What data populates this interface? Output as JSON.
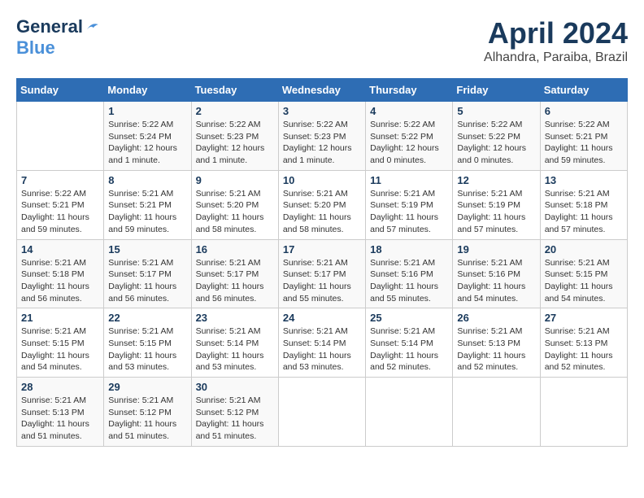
{
  "logo": {
    "text_general": "General",
    "text_blue": "Blue"
  },
  "header": {
    "title": "April 2024",
    "subtitle": "Alhandra, Paraiba, Brazil"
  },
  "weekdays": [
    "Sunday",
    "Monday",
    "Tuesday",
    "Wednesday",
    "Thursday",
    "Friday",
    "Saturday"
  ],
  "weeks": [
    [
      {
        "day": "",
        "info": ""
      },
      {
        "day": "1",
        "info": "Sunrise: 5:22 AM\nSunset: 5:24 PM\nDaylight: 12 hours\nand 1 minute."
      },
      {
        "day": "2",
        "info": "Sunrise: 5:22 AM\nSunset: 5:23 PM\nDaylight: 12 hours\nand 1 minute."
      },
      {
        "day": "3",
        "info": "Sunrise: 5:22 AM\nSunset: 5:23 PM\nDaylight: 12 hours\nand 1 minute."
      },
      {
        "day": "4",
        "info": "Sunrise: 5:22 AM\nSunset: 5:22 PM\nDaylight: 12 hours\nand 0 minutes."
      },
      {
        "day": "5",
        "info": "Sunrise: 5:22 AM\nSunset: 5:22 PM\nDaylight: 12 hours\nand 0 minutes."
      },
      {
        "day": "6",
        "info": "Sunrise: 5:22 AM\nSunset: 5:21 PM\nDaylight: 11 hours\nand 59 minutes."
      }
    ],
    [
      {
        "day": "7",
        "info": "Sunrise: 5:22 AM\nSunset: 5:21 PM\nDaylight: 11 hours\nand 59 minutes."
      },
      {
        "day": "8",
        "info": "Sunrise: 5:21 AM\nSunset: 5:21 PM\nDaylight: 11 hours\nand 59 minutes."
      },
      {
        "day": "9",
        "info": "Sunrise: 5:21 AM\nSunset: 5:20 PM\nDaylight: 11 hours\nand 58 minutes."
      },
      {
        "day": "10",
        "info": "Sunrise: 5:21 AM\nSunset: 5:20 PM\nDaylight: 11 hours\nand 58 minutes."
      },
      {
        "day": "11",
        "info": "Sunrise: 5:21 AM\nSunset: 5:19 PM\nDaylight: 11 hours\nand 57 minutes."
      },
      {
        "day": "12",
        "info": "Sunrise: 5:21 AM\nSunset: 5:19 PM\nDaylight: 11 hours\nand 57 minutes."
      },
      {
        "day": "13",
        "info": "Sunrise: 5:21 AM\nSunset: 5:18 PM\nDaylight: 11 hours\nand 57 minutes."
      }
    ],
    [
      {
        "day": "14",
        "info": "Sunrise: 5:21 AM\nSunset: 5:18 PM\nDaylight: 11 hours\nand 56 minutes."
      },
      {
        "day": "15",
        "info": "Sunrise: 5:21 AM\nSunset: 5:17 PM\nDaylight: 11 hours\nand 56 minutes."
      },
      {
        "day": "16",
        "info": "Sunrise: 5:21 AM\nSunset: 5:17 PM\nDaylight: 11 hours\nand 56 minutes."
      },
      {
        "day": "17",
        "info": "Sunrise: 5:21 AM\nSunset: 5:17 PM\nDaylight: 11 hours\nand 55 minutes."
      },
      {
        "day": "18",
        "info": "Sunrise: 5:21 AM\nSunset: 5:16 PM\nDaylight: 11 hours\nand 55 minutes."
      },
      {
        "day": "19",
        "info": "Sunrise: 5:21 AM\nSunset: 5:16 PM\nDaylight: 11 hours\nand 54 minutes."
      },
      {
        "day": "20",
        "info": "Sunrise: 5:21 AM\nSunset: 5:15 PM\nDaylight: 11 hours\nand 54 minutes."
      }
    ],
    [
      {
        "day": "21",
        "info": "Sunrise: 5:21 AM\nSunset: 5:15 PM\nDaylight: 11 hours\nand 54 minutes."
      },
      {
        "day": "22",
        "info": "Sunrise: 5:21 AM\nSunset: 5:15 PM\nDaylight: 11 hours\nand 53 minutes."
      },
      {
        "day": "23",
        "info": "Sunrise: 5:21 AM\nSunset: 5:14 PM\nDaylight: 11 hours\nand 53 minutes."
      },
      {
        "day": "24",
        "info": "Sunrise: 5:21 AM\nSunset: 5:14 PM\nDaylight: 11 hours\nand 53 minutes."
      },
      {
        "day": "25",
        "info": "Sunrise: 5:21 AM\nSunset: 5:14 PM\nDaylight: 11 hours\nand 52 minutes."
      },
      {
        "day": "26",
        "info": "Sunrise: 5:21 AM\nSunset: 5:13 PM\nDaylight: 11 hours\nand 52 minutes."
      },
      {
        "day": "27",
        "info": "Sunrise: 5:21 AM\nSunset: 5:13 PM\nDaylight: 11 hours\nand 52 minutes."
      }
    ],
    [
      {
        "day": "28",
        "info": "Sunrise: 5:21 AM\nSunset: 5:13 PM\nDaylight: 11 hours\nand 51 minutes."
      },
      {
        "day": "29",
        "info": "Sunrise: 5:21 AM\nSunset: 5:12 PM\nDaylight: 11 hours\nand 51 minutes."
      },
      {
        "day": "30",
        "info": "Sunrise: 5:21 AM\nSunset: 5:12 PM\nDaylight: 11 hours\nand 51 minutes."
      },
      {
        "day": "",
        "info": ""
      },
      {
        "day": "",
        "info": ""
      },
      {
        "day": "",
        "info": ""
      },
      {
        "day": "",
        "info": ""
      }
    ]
  ]
}
